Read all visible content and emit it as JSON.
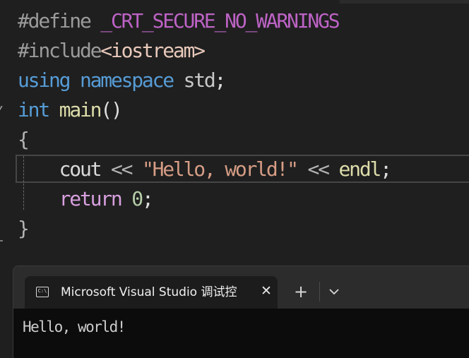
{
  "editor": {
    "line1": {
      "directive": "#define",
      "macro": "_CRT_SECURE_NO_WARNINGS"
    },
    "line2": {
      "directive": "#include",
      "header": "<iostream>"
    },
    "line3": {
      "kw_using": "using",
      "kw_namespace": "namespace",
      "ns": "std",
      "semi": ";"
    },
    "line4": {
      "kw_int": "int",
      "fn": "main",
      "parens": "()"
    },
    "line5": {
      "brace": "{"
    },
    "line6": {
      "indent": "    ",
      "id": "cout",
      "op1": "<<",
      "str": "\"Hello, world!\"",
      "op2": "<<",
      "endl": "endl",
      "semi": ";"
    },
    "line7": {
      "indent": "    ",
      "kw_return": "return",
      "num": "0",
      "semi": ";"
    },
    "line8": {
      "brace": "}"
    }
  },
  "terminal": {
    "tab_title": "Microsoft Visual Studio 调试控制台",
    "close_glyph": "✕",
    "new_tab_glyph": "+",
    "output": "Hello, world!"
  },
  "icons": [
    "console-icon",
    "close-icon",
    "plus-icon",
    "chevron-down-icon"
  ]
}
